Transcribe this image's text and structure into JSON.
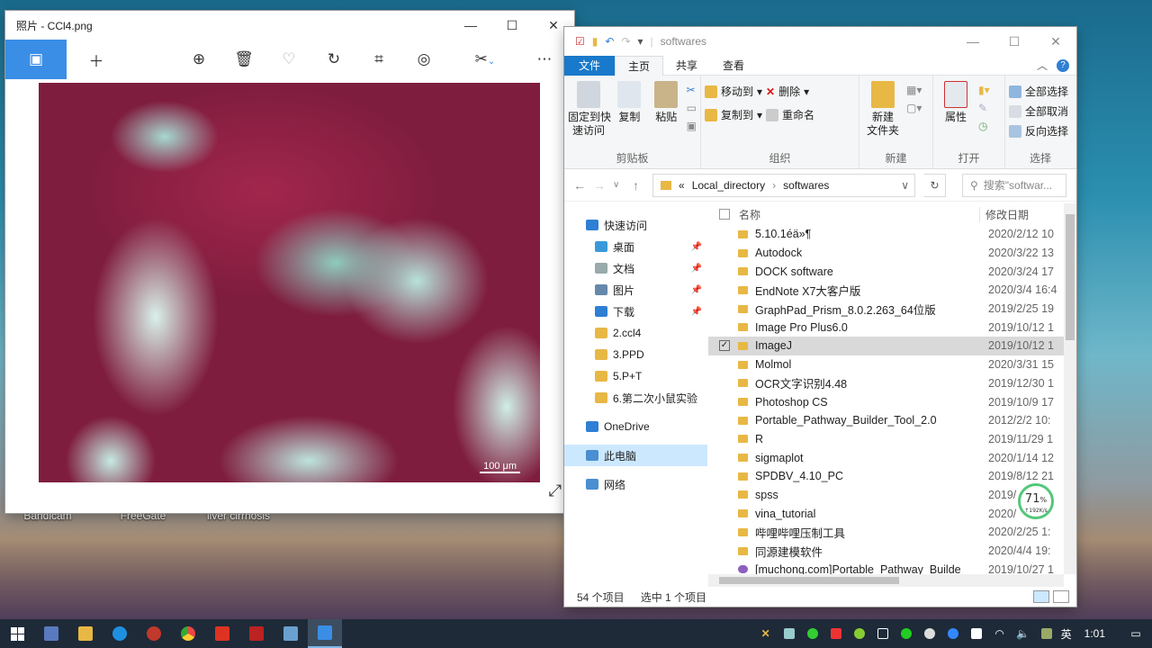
{
  "desktop": {
    "icons": [
      {
        "label": "Bandicam"
      },
      {
        "label": "FreeGate"
      },
      {
        "label": "liver cirrhosis"
      }
    ]
  },
  "photos": {
    "title": "照片 - CCl4.png",
    "image_scale_text": "100 μm",
    "toolbar": [
      "view-image-icon",
      "add-icon",
      "zoom-icon",
      "delete-icon",
      "favorite-icon",
      "rotate-icon",
      "crop-icon",
      "enhance-icon",
      "edit-icon",
      "more-icon"
    ]
  },
  "explorer": {
    "title": "softwares",
    "tabs": {
      "file": "文件",
      "home": "主页",
      "share": "共享",
      "view": "查看"
    },
    "ribbon": {
      "pin": "固定到快\n速访问",
      "copy": "复制",
      "paste": "粘贴",
      "clipboard": "剪贴板",
      "move_to": "移动到",
      "copy_to": "复制到",
      "delete": "删除",
      "rename": "重命名",
      "organize": "组织",
      "new_folder": "新建\n文件夹",
      "new_group": "新建",
      "properties": "属性",
      "open_group": "打开",
      "select_all": "全部选择",
      "select_none": "全部取消",
      "invert": "反向选择",
      "select_group": "选择"
    },
    "address": {
      "prefix": "«",
      "path1": "Local_directory",
      "path2": "softwares"
    },
    "search_placeholder": "搜索\"softwar...",
    "nav": [
      {
        "label": "快速访问",
        "level": 1,
        "pinned": false
      },
      {
        "label": "桌面",
        "level": 2,
        "pinned": true
      },
      {
        "label": "文档",
        "level": 2,
        "pinned": true
      },
      {
        "label": "图片",
        "level": 2,
        "pinned": true
      },
      {
        "label": "下载",
        "level": 2,
        "pinned": true
      },
      {
        "label": "2.ccl4",
        "level": 2,
        "pinned": false
      },
      {
        "label": "3.PPD",
        "level": 2,
        "pinned": false
      },
      {
        "label": "5.P+T",
        "level": 2,
        "pinned": false
      },
      {
        "label": "6.第二次小鼠实验",
        "level": 2,
        "pinned": false
      },
      {
        "label": "OneDrive",
        "level": 1,
        "pinned": false
      },
      {
        "label": "此电脑",
        "level": 1,
        "pinned": false,
        "selected": true
      },
      {
        "label": "网络",
        "level": 1,
        "pinned": false
      }
    ],
    "columns": {
      "name": "名称",
      "date": "修改日期"
    },
    "files": [
      {
        "name": "5.10.1éä»¶",
        "date": "2020/2/12 10"
      },
      {
        "name": "Autodock",
        "date": "2020/3/22 13"
      },
      {
        "name": "DOCK software",
        "date": "2020/3/24 17"
      },
      {
        "name": "EndNote X7大客户版",
        "date": "2020/3/4 16:4"
      },
      {
        "name": "GraphPad_Prism_8.0.2.263_64位版",
        "date": "2019/2/25 19"
      },
      {
        "name": "Image Pro Plus6.0",
        "date": "2019/10/12 1"
      },
      {
        "name": "ImageJ",
        "date": "2019/10/12 1",
        "selected": true
      },
      {
        "name": "Molmol",
        "date": "2020/3/31 15"
      },
      {
        "name": "OCR文字识别4.48",
        "date": "2019/12/30 1"
      },
      {
        "name": "Photoshop CS",
        "date": "2019/10/9 17"
      },
      {
        "name": "Portable_Pathway_Builder_Tool_2.0",
        "date": "2012/2/2 10:"
      },
      {
        "name": "R",
        "date": "2019/11/29 1"
      },
      {
        "name": "sigmaplot",
        "date": "2020/1/14 12"
      },
      {
        "name": "SPDBV_4.10_PC",
        "date": "2019/8/12 21"
      },
      {
        "name": "spss",
        "date": "2019/"
      },
      {
        "name": "vina_tutorial",
        "date": "2020/"
      },
      {
        "name": "哔哩哔哩压制工具",
        "date": "2020/2/25 1:"
      },
      {
        "name": "同源建模软件",
        "date": "2020/4/4 19:"
      },
      {
        "name": "[muchong.com]Portable_Pathway_Builde",
        "date": "2019/10/27 1",
        "is_file": true
      }
    ],
    "status": {
      "count": "54 个项目",
      "selected": "选中 1 个项目"
    },
    "speed_widget": {
      "percent": "71",
      "unit": "%",
      "rate": "↑192K/s"
    }
  },
  "taskbar": {
    "apps": [
      "start-icon",
      "task-view-icon",
      "file-explorer-icon",
      "edge-icon",
      "app-red-icon",
      "chrome-icon",
      "acrobat-icon",
      "app-pdf-icon",
      "app-tools-icon",
      "photos-icon"
    ],
    "ime": "英",
    "time": "1:01"
  }
}
